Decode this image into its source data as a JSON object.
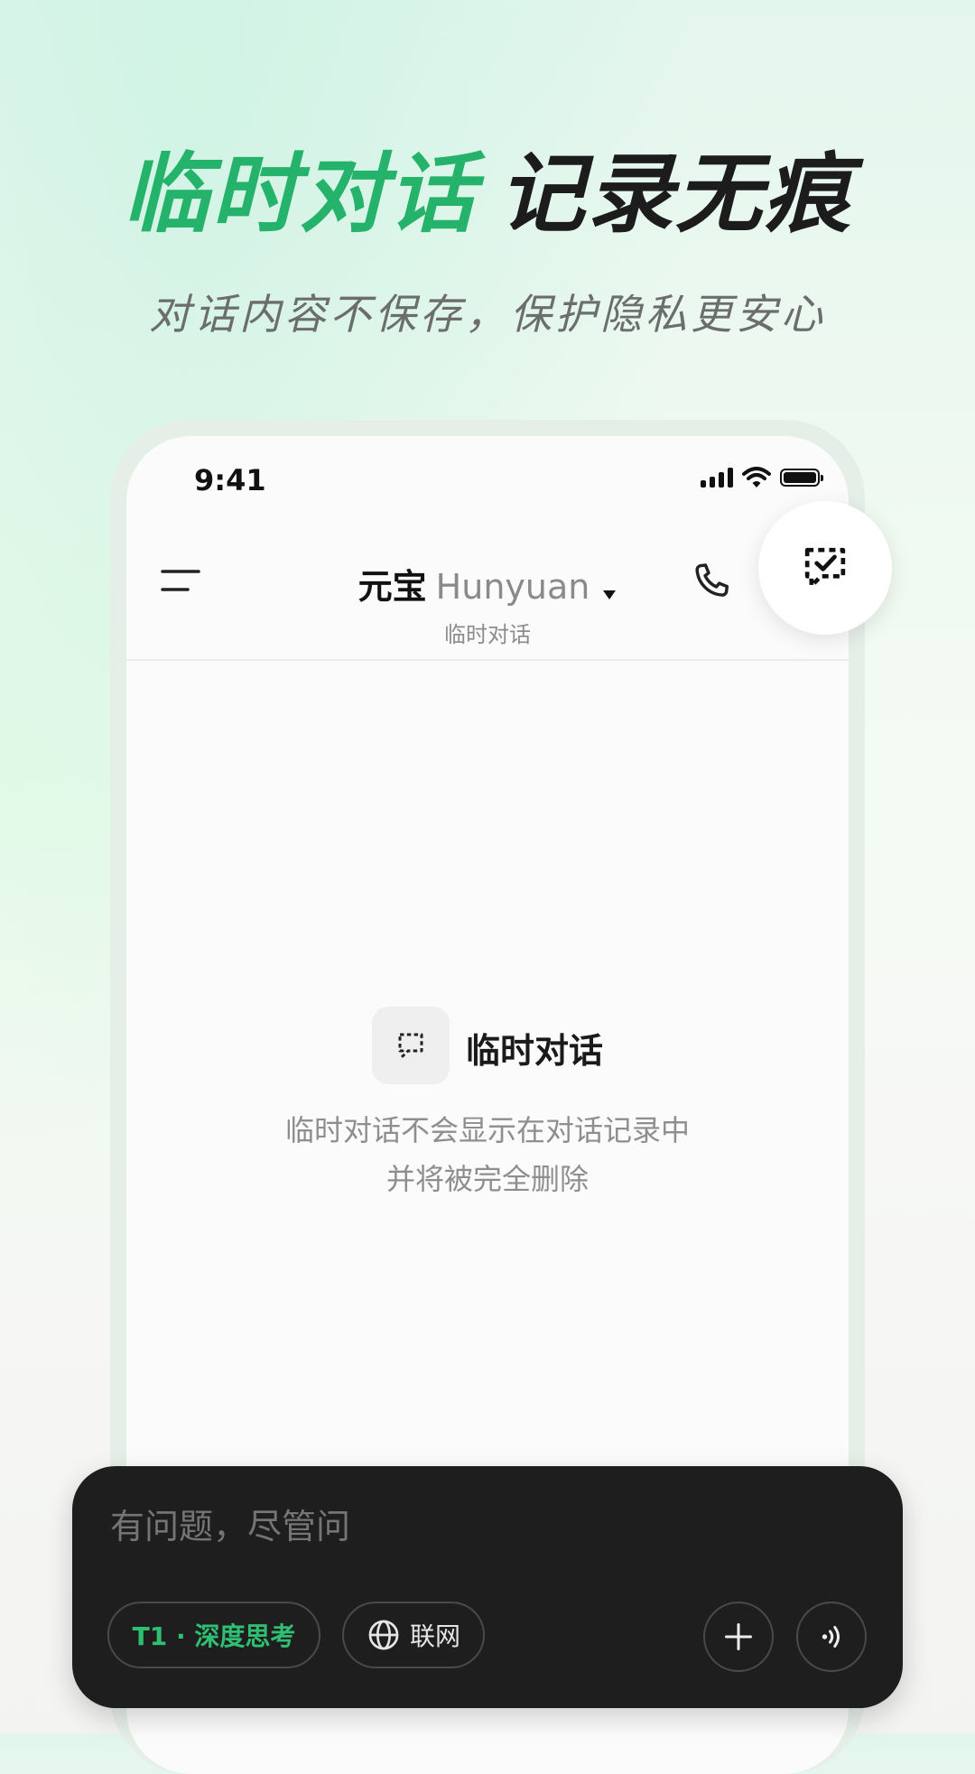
{
  "promo": {
    "headline_green": "临时对话",
    "headline_black": "记录无痕",
    "subline": "对话内容不保存，保护隐私更安心"
  },
  "status_bar": {
    "time": "9:41"
  },
  "header": {
    "app_name": "元宝",
    "model_name": "Hunyuan",
    "subtitle": "临时对话"
  },
  "empty_state": {
    "title": "临时对话",
    "desc_line1": "临时对话不会显示在对话记录中",
    "desc_line2": "并将被完全删除"
  },
  "composer": {
    "placeholder": "有问题，尽管问",
    "deep_think_label": "T1 · 深度思考",
    "web_label": "联网"
  },
  "colors": {
    "accent_green": "#25b26b",
    "composer_bg": "#1e1e1e"
  },
  "icons": {
    "menu": "menu-icon",
    "model_dropdown": "caret-down-icon",
    "call": "phone-icon",
    "temp_chat": "temp-chat-checked-icon",
    "empty_state": "temp-chat-icon",
    "web": "globe-icon",
    "add": "plus-icon",
    "voice": "voice-icon"
  }
}
